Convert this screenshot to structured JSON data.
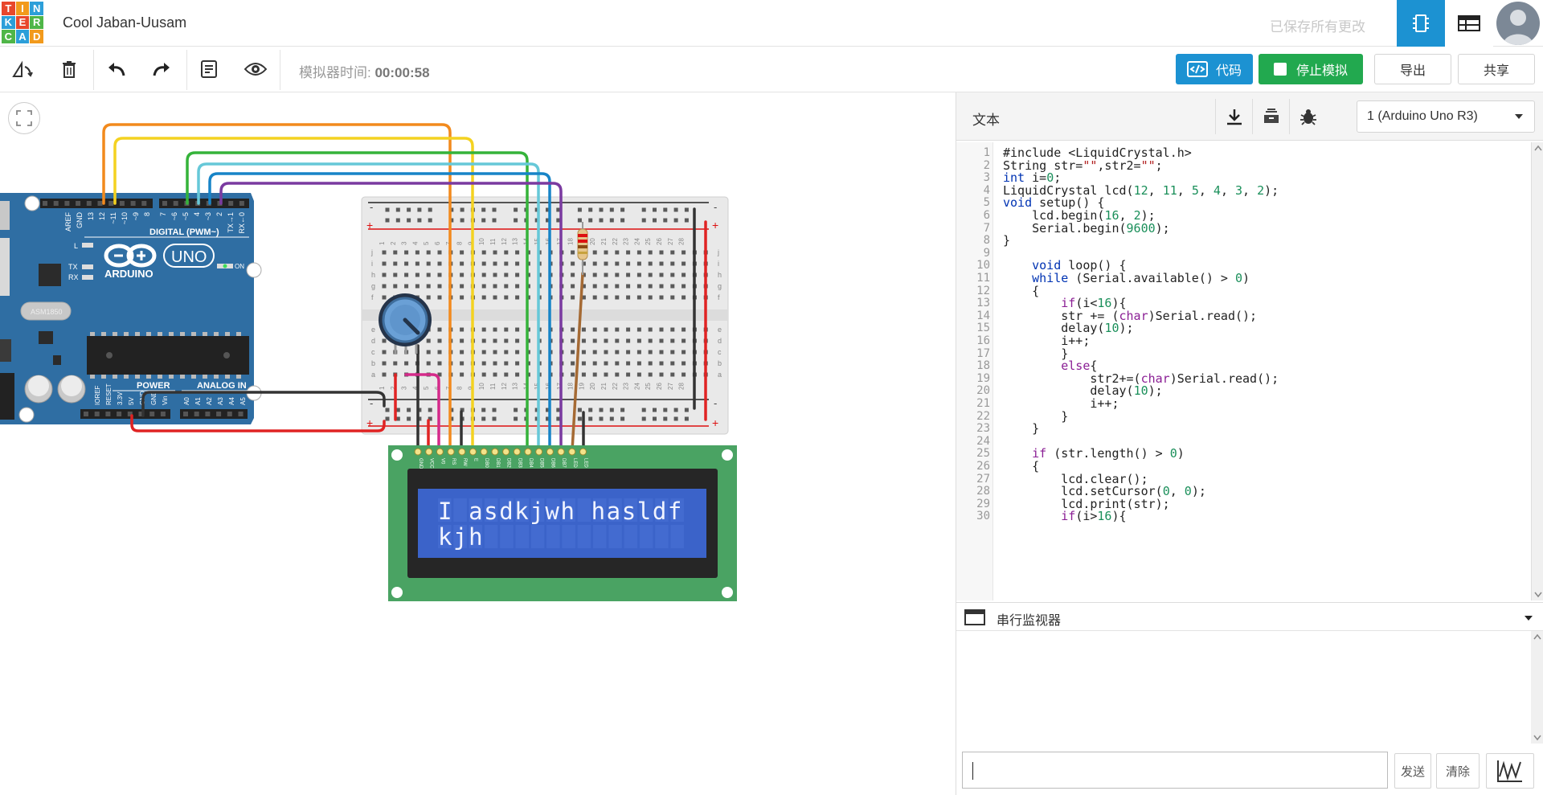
{
  "app": {
    "logo_letters": [
      "T",
      "I",
      "N",
      "K",
      "E",
      "R",
      "C",
      "A",
      "D"
    ],
    "project_title": "Cool Jaban-Uusam",
    "saved_status": "已保存所有更改"
  },
  "toolbar": {
    "sim_time_label": "模拟器时间:",
    "sim_time_value": "00:00:58",
    "code_label": "代码",
    "stop_sim_label": "停止模拟",
    "export_label": "导出",
    "share_label": "共享"
  },
  "code_panel": {
    "title": "文本",
    "board_select": "1 (Arduino Uno R3)",
    "lines": [
      "#include <LiquidCrystal.h>",
      "String str=\"\",str2=\"\";",
      "int i=0;",
      "LiquidCrystal lcd(12, 11, 5, 4, 3, 2);",
      "void setup() {",
      "    lcd.begin(16, 2);",
      "    Serial.begin(9600);",
      "}",
      "",
      "    void loop() {",
      "    while (Serial.available() > 0)",
      "    {",
      "        if(i<16){",
      "        str += (char)Serial.read();",
      "        delay(10);",
      "        i++;",
      "        }",
      "        else{",
      "            str2+=(char)Serial.read();",
      "            delay(10);",
      "            i++;",
      "        }",
      "    }",
      "",
      "    if (str.length() > 0)",
      "    {",
      "        lcd.clear();",
      "        lcd.setCursor(0, 0);",
      "        lcd.print(str);",
      "        if(i>16){"
    ]
  },
  "serial_monitor": {
    "title": "串行监视器",
    "input_value": "",
    "send_label": "发送",
    "clear_label": "清除"
  },
  "lcd": {
    "line1": "I asdkjwh hasldf",
    "line2": "kjh"
  },
  "arduino": {
    "brand": "ARDUINO",
    "model": "UNO",
    "digital_label": "DIGITAL (PWM~)",
    "power_label": "POWER",
    "analog_label": "ANALOG IN",
    "on_label": "ON",
    "l_label": "L",
    "tx_label": "TX",
    "rx_label": "RX",
    "chip_label": "ASM1850",
    "top_pins": [
      "AREF",
      "GND",
      "13",
      "12",
      "~11",
      "~10",
      "~9",
      "8",
      "7",
      "~6",
      "~5",
      "4",
      "~3",
      "2",
      "TX→1",
      "RX←0"
    ],
    "bottom_pins": [
      "IOREF",
      "RESET",
      "3.3V",
      "5V",
      "GND",
      "GND",
      "Vin",
      "A0",
      "A1",
      "A2",
      "A3",
      "A4",
      "A5"
    ]
  },
  "lcd_pins": [
    "GND",
    "VCC",
    "V0",
    "RS",
    "RW",
    "E",
    "DB0",
    "DB1",
    "DB2",
    "DB3",
    "DB4",
    "DB5",
    "DB6",
    "DB7",
    "LED",
    "LED"
  ],
  "breadboard": {
    "plus": "+",
    "minus": "-",
    "row_letters_top": [
      "j",
      "i",
      "h",
      "g",
      "f"
    ],
    "row_letters_bottom": [
      "e",
      "d",
      "c",
      "b",
      "a"
    ],
    "columns": [
      "1",
      "2",
      "3",
      "4",
      "5",
      "6",
      "7",
      "8",
      "9",
      "10",
      "11",
      "12",
      "13",
      "14",
      "15",
      "16",
      "17",
      "18",
      "19",
      "20",
      "21",
      "22",
      "23",
      "24",
      "25",
      "26",
      "27",
      "28",
      "29",
      "30"
    ]
  },
  "colors": {
    "accent_blue": "#1c92d2",
    "stop_green": "#22a94f",
    "arduino_blue": "#2f6ea3",
    "pcb_green": "#4aa363",
    "lcd_blue": "#3b63c9"
  }
}
